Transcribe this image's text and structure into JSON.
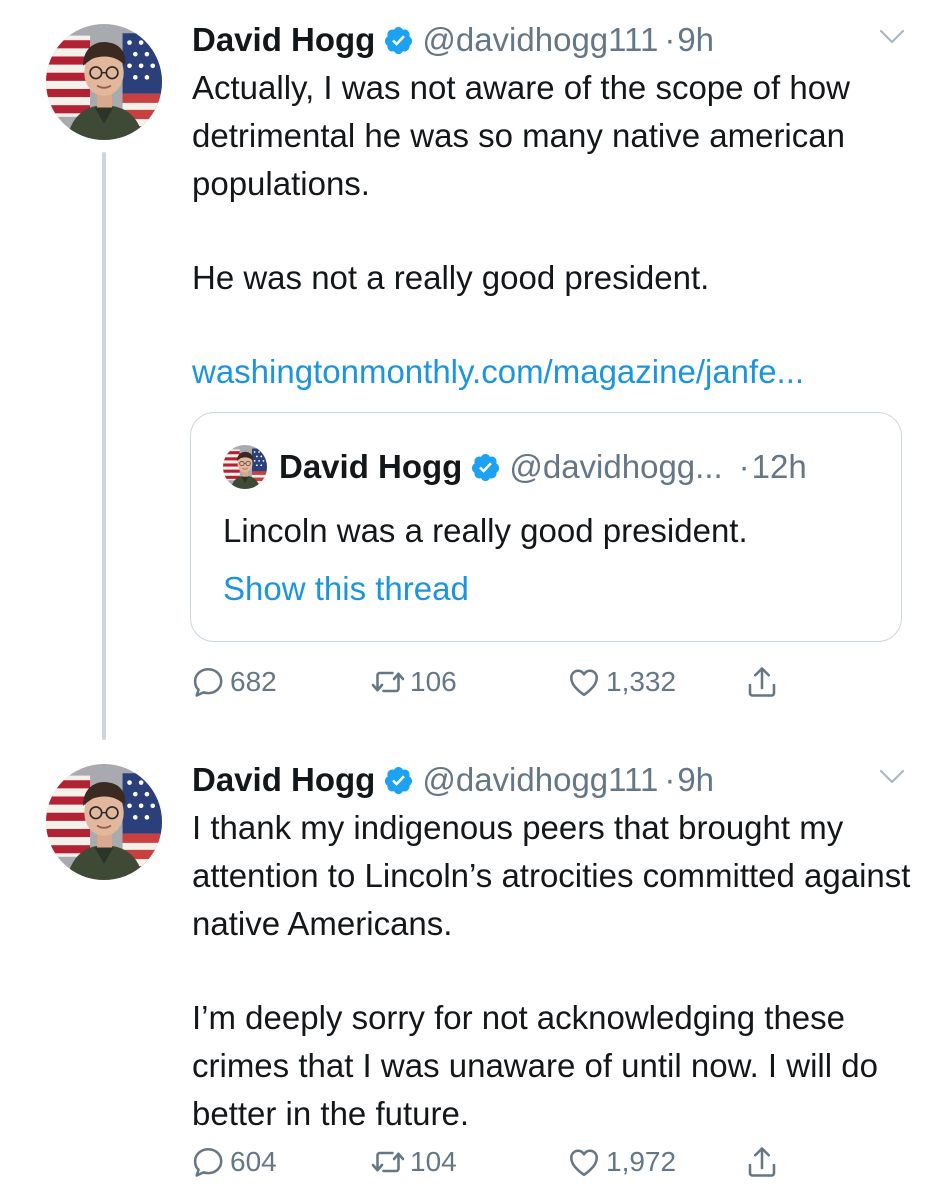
{
  "tweets": [
    {
      "name": "David Hogg",
      "handle": "@davidhogg111",
      "time": "9h",
      "paragraphs": [
        "Actually, I was not aware of the scope of how detrimental he was so many native american populations.",
        "He was not a really good president."
      ],
      "link": "washingtonmonthly.com/magazine/janfe...",
      "quote": {
        "name": "David Hogg",
        "handle": "@davidhogg...",
        "time": "12h",
        "text": "Lincoln was a really good president.",
        "show_thread": "Show this thread"
      },
      "replies": "682",
      "retweets": "106",
      "likes": "1,332"
    },
    {
      "name": "David Hogg",
      "handle": "@davidhogg111",
      "time": "9h",
      "paragraphs": [
        "I thank my indigenous peers that brought my attention to Lincoln’s atrocities committed against native Americans.",
        "I’m deeply sorry for not acknowledging these crimes that I was unaware of until now. I will do better in the future."
      ],
      "replies": "604",
      "retweets": "104",
      "likes": "1,972"
    }
  ],
  "icons": {
    "verified": "verified-badge-icon",
    "caret": "chevron-down-icon",
    "reply": "reply-icon",
    "retweet": "retweet-icon",
    "like": "heart-icon",
    "share": "share-icon"
  },
  "colors": {
    "text": "#14171a",
    "secondary": "#657786",
    "link": "#1b95e0",
    "verified": "#1da1f2",
    "border": "#ccd6dd"
  }
}
